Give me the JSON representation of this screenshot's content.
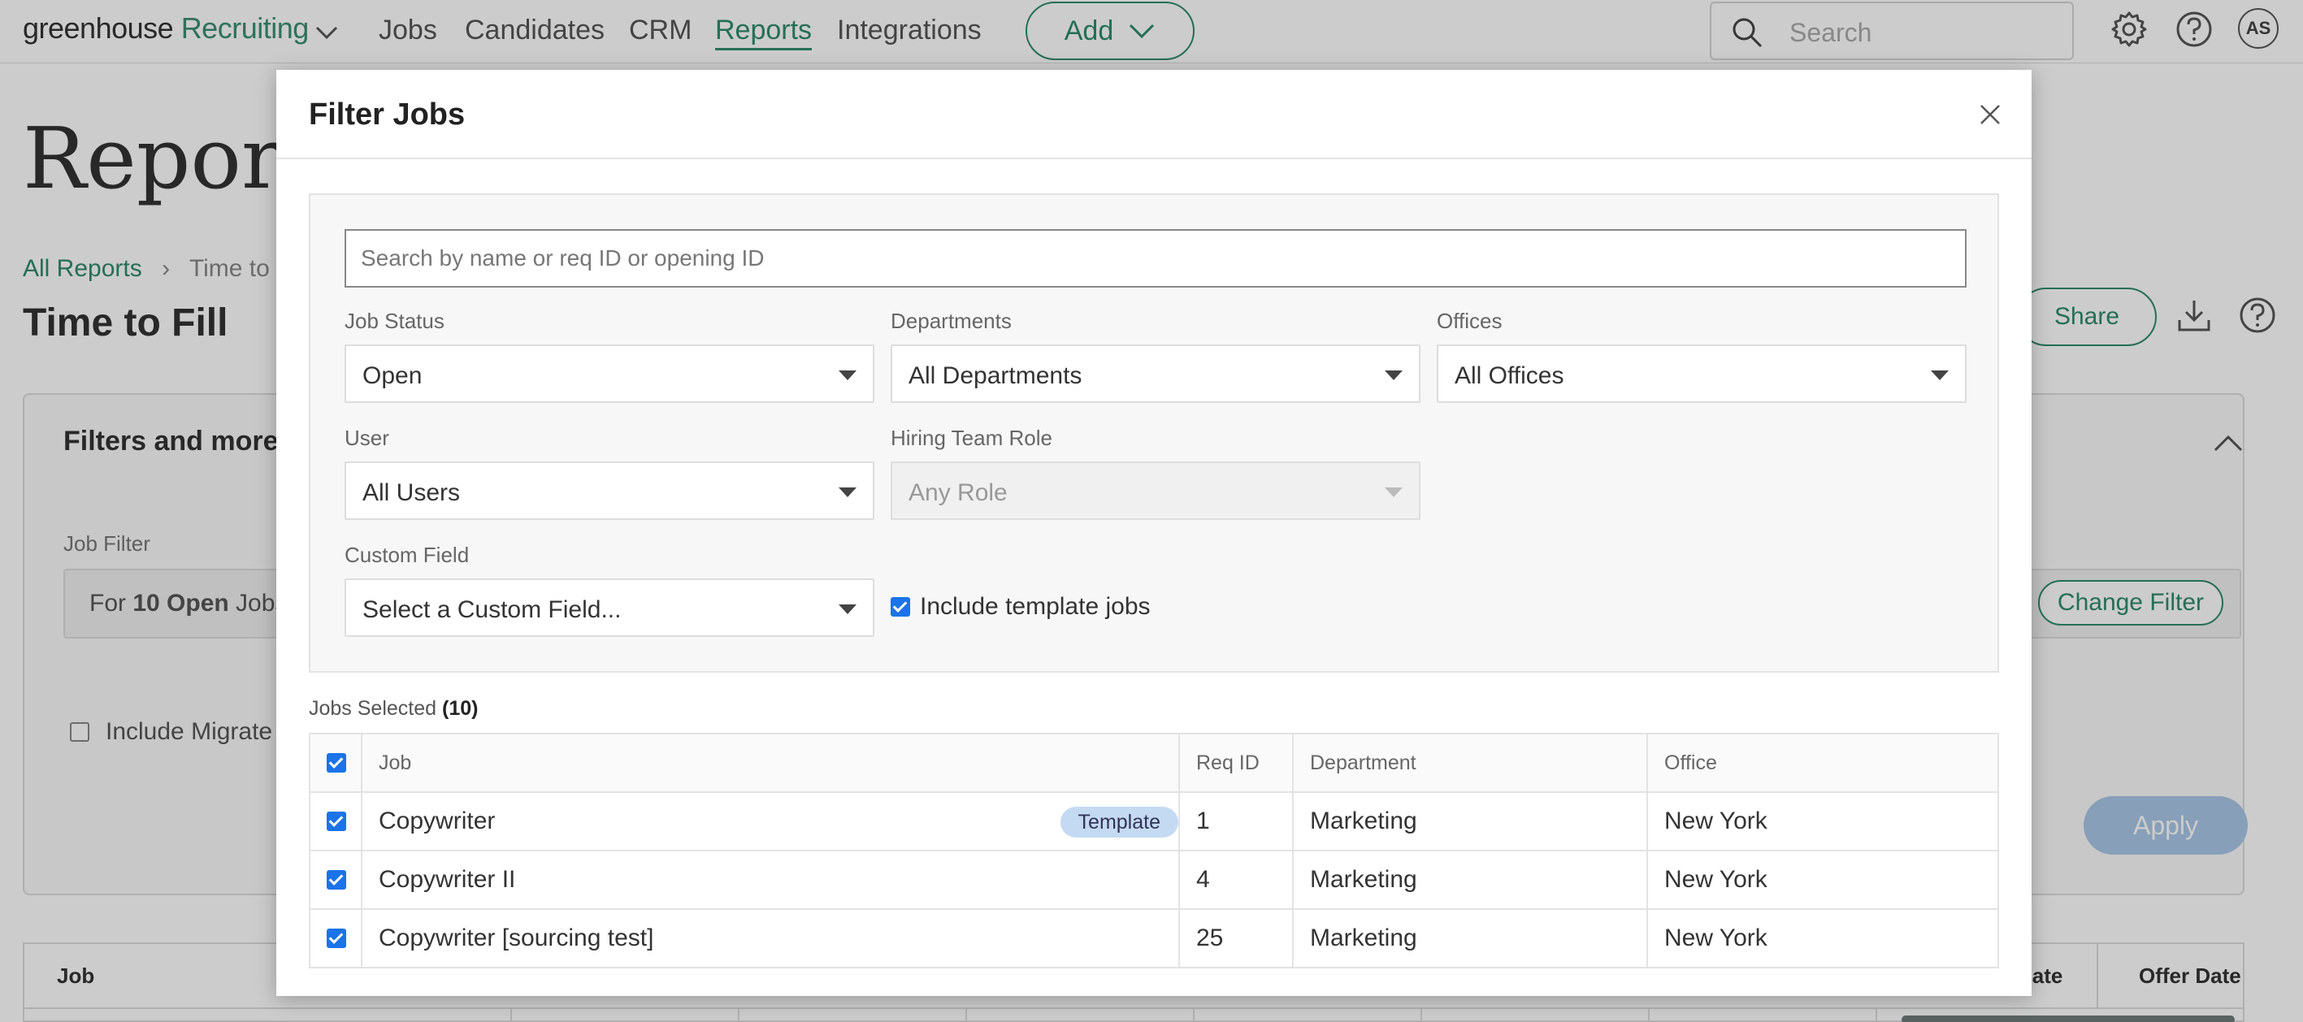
{
  "nav": {
    "brand_main": "greenhouse",
    "brand_sub": "Recruiting",
    "items": [
      "Jobs",
      "Candidates",
      "CRM",
      "Reports",
      "Integrations"
    ],
    "active": "Reports",
    "add_label": "Add",
    "search_placeholder": "Search",
    "avatar_initials": "AS"
  },
  "page": {
    "title": "Reports",
    "breadcrumb_root": "All Reports",
    "breadcrumb_current": "Time to F",
    "report_title": "Time to Fill",
    "share_label": "Share"
  },
  "filters_card": {
    "title": "Filters and more",
    "job_filter_label": "Job Filter",
    "job_filter_prefix": "For ",
    "job_filter_bold": "10 Open",
    "job_filter_suffix": " Jobs",
    "change_filter_label": "Change Filter",
    "include_migrated_label": "Include Migrate",
    "apply_label": "Apply"
  },
  "bottom_table": {
    "col_job": "Job",
    "col_date": "Date",
    "col_offer": "Offer Date"
  },
  "modal": {
    "title": "Filter Jobs",
    "search_placeholder": "Search by name or req ID or opening ID",
    "job_status": {
      "label": "Job Status",
      "value": "Open"
    },
    "departments": {
      "label": "Departments",
      "value": "All Departments"
    },
    "offices": {
      "label": "Offices",
      "value": "All Offices"
    },
    "user": {
      "label": "User",
      "value": "All Users"
    },
    "hiring_team_role": {
      "label": "Hiring Team Role",
      "value": "Any Role"
    },
    "custom_field": {
      "label": "Custom Field",
      "value": "Select a Custom Field..."
    },
    "include_template_label": "Include template jobs",
    "jobs_selected_label": "Jobs Selected",
    "jobs_selected_count": "(10)",
    "table": {
      "headers": {
        "job": "Job",
        "req_id": "Req ID",
        "department": "Department",
        "office": "Office"
      },
      "rows": [
        {
          "job": "Copywriter",
          "badge": "Template",
          "req_id": "1",
          "department": "Marketing",
          "office": "New York"
        },
        {
          "job": "Copywriter II",
          "badge": "",
          "req_id": "4",
          "department": "Marketing",
          "office": "New York"
        },
        {
          "job": "Copywriter [sourcing test]",
          "badge": "",
          "req_id": "25",
          "department": "Marketing",
          "office": "New York"
        }
      ]
    }
  },
  "colors": {
    "brand_green": "#2f8a6c",
    "checkbox_blue": "#1a73e8",
    "template_badge": "#c4daf2",
    "apply_disabled": "#a9c7e6"
  },
  "icons": [
    "chevron-down-icon",
    "search-icon",
    "gear-icon",
    "help-icon",
    "download-icon",
    "chevron-up-icon",
    "close-icon"
  ]
}
